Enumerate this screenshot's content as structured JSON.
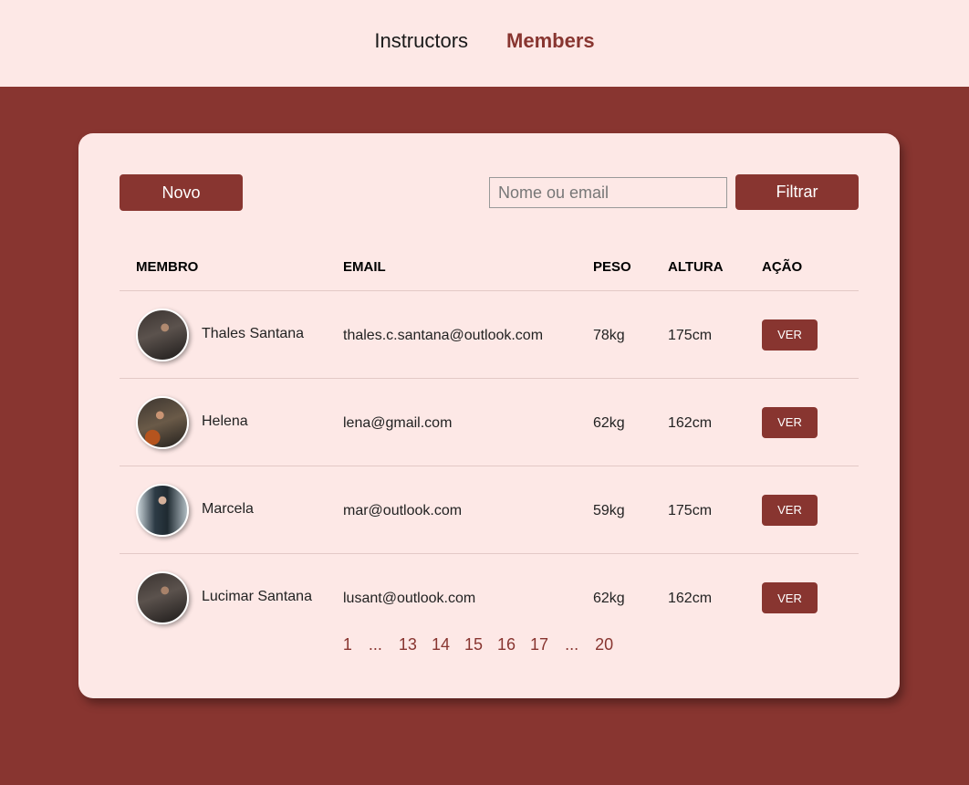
{
  "nav": {
    "instructors": "Instructors",
    "members": "Members"
  },
  "toolbar": {
    "new_label": "Novo",
    "search_placeholder": "Nome ou email",
    "search_value": "",
    "filter_label": "Filtrar"
  },
  "table": {
    "headers": {
      "member": "MEMBRO",
      "email": "EMAIL",
      "weight": "PESO",
      "height": "ALTURA",
      "action": "AÇÃO"
    },
    "rows": [
      {
        "name": "Thales Santana",
        "email": "thales.c.santana@outlook.com",
        "weight": "78kg",
        "height": "175cm",
        "action": "VER"
      },
      {
        "name": "Helena",
        "email": "lena@gmail.com",
        "weight": "62kg",
        "height": "162cm",
        "action": "VER"
      },
      {
        "name": "Marcela",
        "email": "mar@outlook.com",
        "weight": "59kg",
        "height": "175cm",
        "action": "VER"
      },
      {
        "name": "Lucimar Santana",
        "email": "lusant@outlook.com",
        "weight": "62kg",
        "height": "162cm",
        "action": "VER"
      }
    ]
  },
  "pagination": {
    "first": "1",
    "ellipsis_left": "...",
    "pages": [
      "13",
      "14",
      "15",
      "16",
      "17"
    ],
    "ellipsis_right": "...",
    "last": "20"
  },
  "colors": {
    "primary": "#883530",
    "surface": "#fde8e6"
  }
}
